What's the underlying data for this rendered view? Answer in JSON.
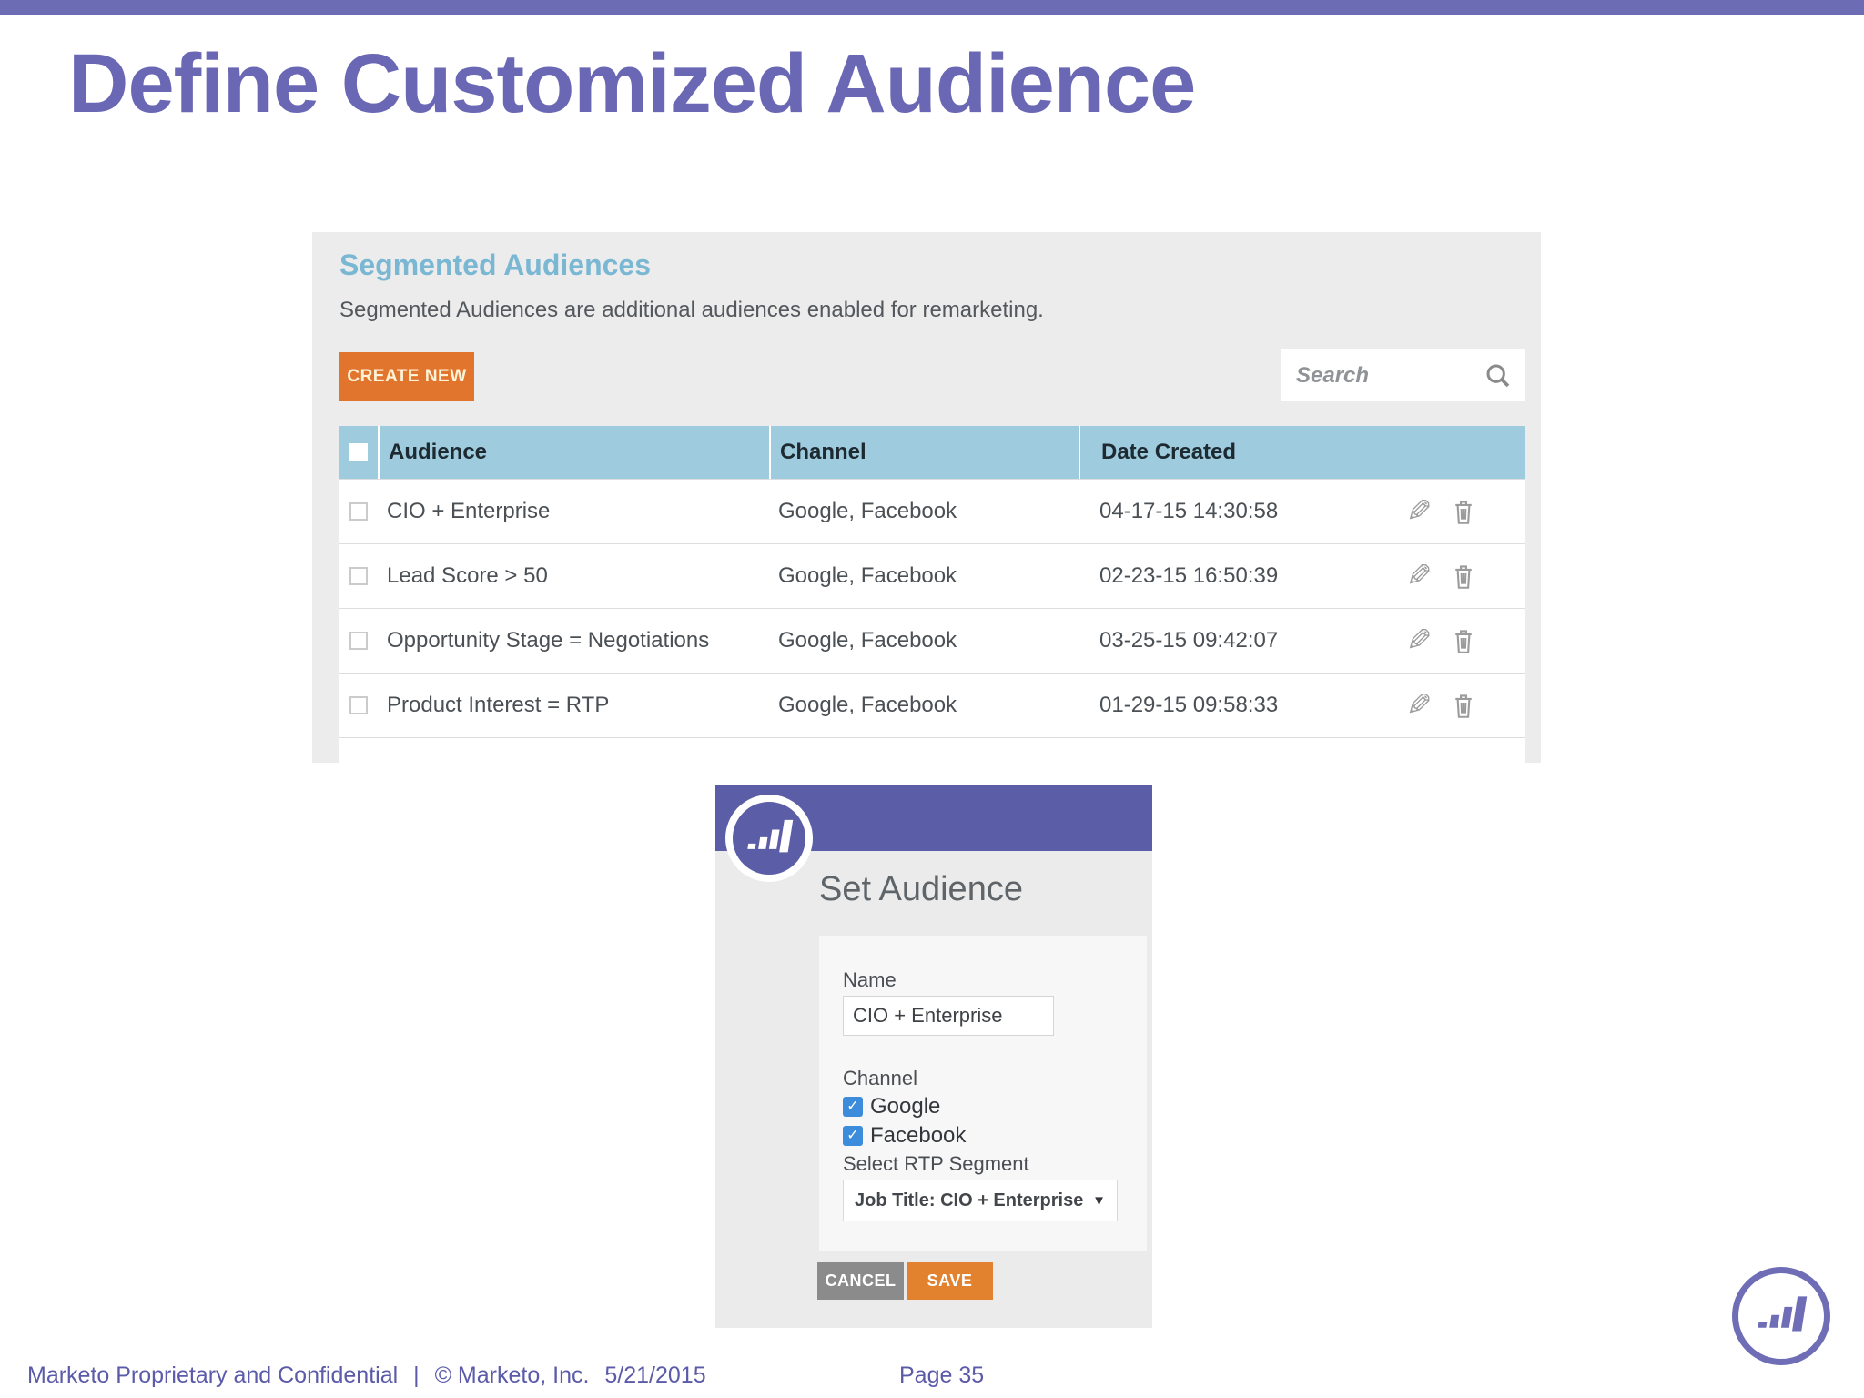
{
  "slide": {
    "title": "Define Customized Audience",
    "footer": {
      "confidential": "Marketo Proprietary and Confidential",
      "separator": "|",
      "copyright": "© Marketo, Inc.",
      "date": "5/21/2015",
      "page": "Page 35"
    }
  },
  "audiences_panel": {
    "heading": "Segmented Audiences",
    "description": "Segmented Audiences are additional audiences enabled for remarketing.",
    "create_button_label": "CREATE NEW",
    "search_placeholder": "Search",
    "table": {
      "columns": [
        "Audience",
        "Channel",
        "Date Created"
      ],
      "rows": [
        {
          "audience": "CIO + Enterprise",
          "channel": "Google, Facebook",
          "date_created": "04-17-15 14:30:58"
        },
        {
          "audience": "Lead Score > 50",
          "channel": "Google, Facebook",
          "date_created": "02-23-15 16:50:39"
        },
        {
          "audience": "Opportunity Stage = Negotiations",
          "channel": "Google, Facebook",
          "date_created": "03-25-15 09:42:07"
        },
        {
          "audience": "Product Interest = RTP",
          "channel": "Google, Facebook",
          "date_created": "01-29-15 09:58:33"
        }
      ]
    }
  },
  "set_audience_modal": {
    "title": "Set Audience",
    "name_label": "Name",
    "name_value": "CIO + Enterprise",
    "channel_label": "Channel",
    "channels": [
      {
        "label": "Google",
        "checked": true
      },
      {
        "label": "Facebook",
        "checked": true
      }
    ],
    "segment_label": "Select RTP Segment",
    "segment_value": "Job Title: CIO + Enterprise",
    "cancel_label": "CANCEL",
    "save_label": "SAVE"
  },
  "icons": {
    "edit_glyph": "✎",
    "caret_glyph": "▼",
    "check_glyph": "✓"
  },
  "colors": {
    "slide_accent_purple": "#6C6CB5",
    "title_purple": "#6A68B4",
    "panel_heading_blue": "#79B7D3",
    "table_header_blue": "#9FCBDE",
    "primary_orange": "#E2752E",
    "save_orange": "#E2812E",
    "cancel_gray": "#8B8B8B",
    "modal_header_purple": "#5B5EA6",
    "checkbox_blue": "#3D8BDB",
    "footer_purple": "#5B5BA9"
  }
}
